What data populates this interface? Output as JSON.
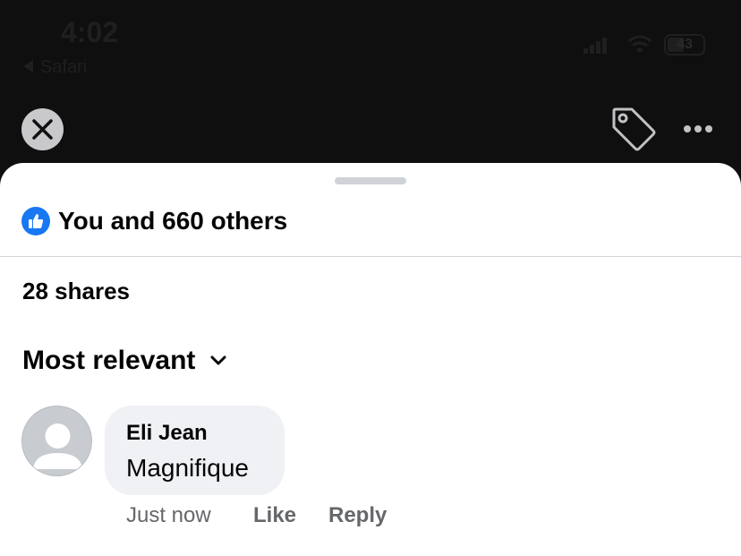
{
  "status_bar": {
    "time": "4:02",
    "back_app": "Safari",
    "battery_percent": "43",
    "icons": [
      "cellular-signal-icon",
      "wifi-icon",
      "battery-icon"
    ]
  },
  "toolbar": {
    "icons": [
      "close-icon",
      "tag-icon",
      "more-icon"
    ]
  },
  "sheet": {
    "reactions_text": "You and 660 others",
    "shares_text": "28 shares",
    "sort_label": "Most relevant"
  },
  "comments": [
    {
      "author": "Eli Jean",
      "text": "Magnifique",
      "timestamp": "Just now",
      "like_label": "Like",
      "reply_label": "Reply"
    }
  ],
  "colors": {
    "background": "#0f0f0f",
    "sheet": "#ffffff",
    "like_blue": "#1877f2",
    "bubble": "#f0f1f5",
    "secondary_text": "#65676b"
  }
}
